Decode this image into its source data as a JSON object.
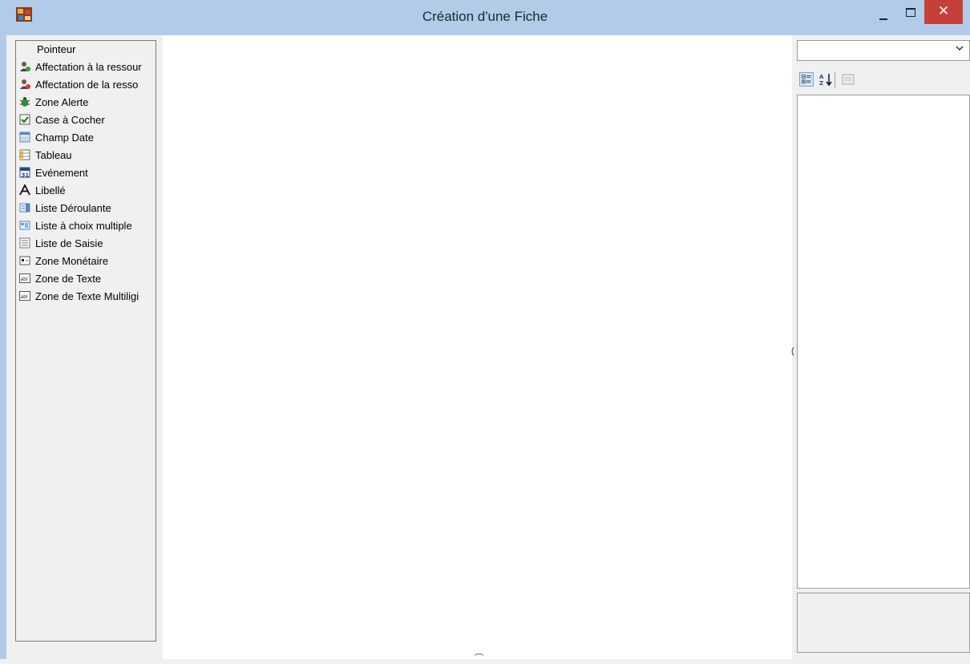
{
  "window": {
    "title": "Création d'une Fiche",
    "close_glyph": "✕"
  },
  "toolbox": {
    "items": [
      {
        "label": "Pointeur",
        "icon": "pointer-icon"
      },
      {
        "label": "Affectation à la ressour",
        "icon": "user-assign-icon"
      },
      {
        "label": "Affectation de la resso",
        "icon": "user-unassign-icon"
      },
      {
        "label": "Zone Alerte",
        "icon": "bug-alert-icon"
      },
      {
        "label": "Case à Cocher",
        "icon": "checkbox-icon"
      },
      {
        "label": "Champ Date",
        "icon": "calendar-icon"
      },
      {
        "label": "Tableau",
        "icon": "table-icon"
      },
      {
        "label": "Evénement",
        "icon": "event-icon"
      },
      {
        "label": "Libellé",
        "icon": "label-icon"
      },
      {
        "label": "Liste Déroulante",
        "icon": "dropdown-list-icon"
      },
      {
        "label": "Liste à choix multiple",
        "icon": "multi-choice-list-icon"
      },
      {
        "label": "Liste de Saisie",
        "icon": "input-list-icon"
      },
      {
        "label": "Zone Monétaire",
        "icon": "currency-field-icon"
      },
      {
        "label": "Zone de Texte",
        "icon": "textbox-icon"
      },
      {
        "label": "Zone de Texte Multiligi",
        "icon": "multiline-textbox-icon"
      }
    ]
  },
  "canvas": {
    "right_mark": "(",
    "bottom_mark": "⌒"
  },
  "properties": {
    "combo_value": "",
    "toolbar": {
      "categorized_icon": "categorized-icon",
      "alphabetical_icon": "sort-az-icon",
      "property_pages_icon": "property-pages-icon",
      "az_glyph": "A↓"
    }
  },
  "colors": {
    "titlebar": "#b2cbe8",
    "close_button": "#c6403a",
    "panel": "#f0f0f0"
  }
}
